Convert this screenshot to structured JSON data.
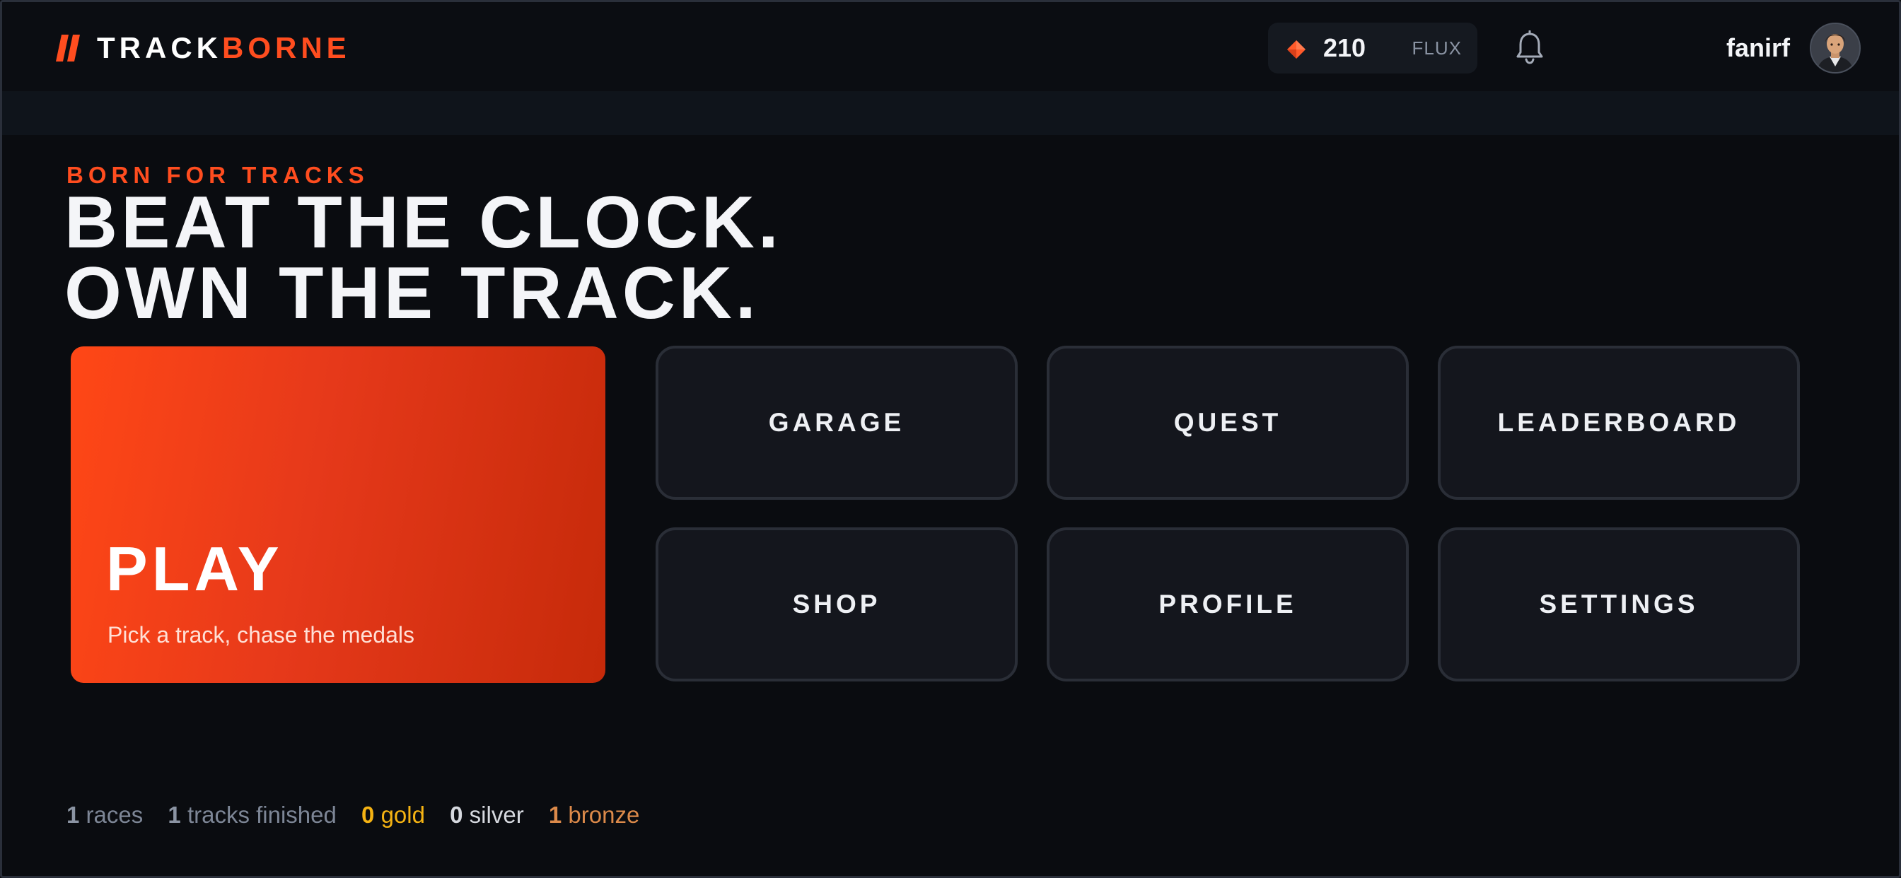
{
  "brand": {
    "name_part1": "TRACK",
    "name_part2": "BORNE",
    "accent_color": "#ff4d1f"
  },
  "header": {
    "currency": {
      "amount": "210",
      "unit": "FLUX",
      "icon": "flux-gem-icon"
    },
    "notifications_icon": "bell-icon",
    "user": {
      "name": "fanirf",
      "avatar_icon": "user-avatar"
    }
  },
  "hero": {
    "tagline": "BORN FOR TRACKS",
    "headline_line1": "BEAT THE CLOCK.",
    "headline_line2": "OWN THE TRACK."
  },
  "play_card": {
    "title": "PLAY",
    "subtitle": "Pick a track, chase the medals"
  },
  "menu": {
    "items": [
      {
        "label": "GARAGE"
      },
      {
        "label": "QUEST"
      },
      {
        "label": "LEADERBOARD"
      },
      {
        "label": "SHOP"
      },
      {
        "label": "PROFILE"
      },
      {
        "label": "SETTINGS"
      }
    ]
  },
  "stats": {
    "races": {
      "value": "1",
      "label": "races"
    },
    "tracks_finished": {
      "value": "1",
      "label": "tracks finished"
    },
    "gold": {
      "value": "0",
      "label": "gold",
      "color": "#f5b313"
    },
    "silver": {
      "value": "0",
      "label": "silver",
      "color": "#d6d9df"
    },
    "bronze": {
      "value": "1",
      "label": "bronze",
      "color": "#dc8a4a"
    }
  }
}
